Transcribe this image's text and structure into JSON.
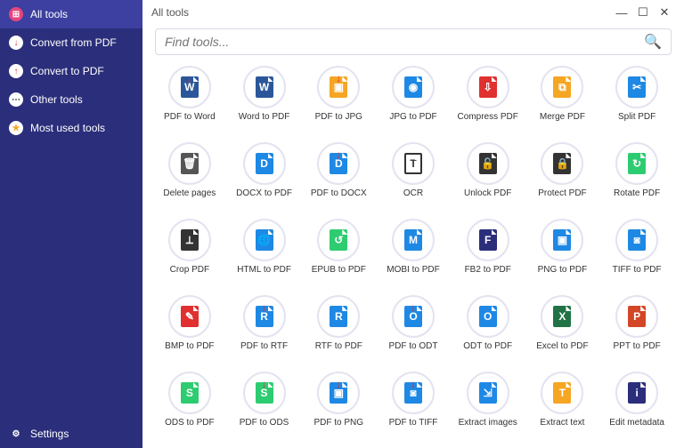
{
  "header": {
    "title": "All tools"
  },
  "search": {
    "placeholder": "Find tools..."
  },
  "win_controls": {
    "minimize": "—",
    "maximize": "☐",
    "close": "✕"
  },
  "sidebar": {
    "items": [
      {
        "label": "All tools",
        "icon_color": "#e5457e",
        "glyph": "⊞",
        "active": true
      },
      {
        "label": "Convert from PDF",
        "icon_color": "#ffffff",
        "glyph": "↓",
        "glyph_color": "#e03030"
      },
      {
        "label": "Convert to PDF",
        "icon_color": "#ffffff",
        "glyph": "↑",
        "glyph_color": "#e03030"
      },
      {
        "label": "Other tools",
        "icon_color": "#ffffff",
        "glyph": "⋯",
        "glyph_color": "#333"
      },
      {
        "label": "Most used tools",
        "icon_color": "#ffffff",
        "glyph": "★",
        "glyph_color": "#f5a623"
      }
    ],
    "settings": {
      "label": "Settings",
      "glyph": "⚙"
    }
  },
  "tools": [
    {
      "label": "PDF to Word",
      "color": "#2b579a",
      "glyph": "W",
      "arrow": true
    },
    {
      "label": "Word to PDF",
      "color": "#2b579a",
      "glyph": "W"
    },
    {
      "label": "PDF to JPG",
      "color": "#f5a623",
      "glyph": "▣",
      "arrow": true
    },
    {
      "label": "JPG to PDF",
      "color": "#1e88e5",
      "glyph": "◉"
    },
    {
      "label": "Compress PDF",
      "color": "#e03030",
      "glyph": "⇩"
    },
    {
      "label": "Merge PDF",
      "color": "#f5a623",
      "glyph": "⧉"
    },
    {
      "label": "Split PDF",
      "color": "#1e88e5",
      "glyph": "✂"
    },
    {
      "label": "Delete pages",
      "color": "#555",
      "glyph": "🗑"
    },
    {
      "label": "DOCX to PDF",
      "color": "#1e88e5",
      "glyph": "D"
    },
    {
      "label": "PDF to DOCX",
      "color": "#1e88e5",
      "glyph": "D",
      "arrow": true
    },
    {
      "label": "OCR",
      "color": "#333",
      "glyph": "T",
      "outline": true
    },
    {
      "label": "Unlock PDF",
      "color": "#333",
      "glyph": "🔓"
    },
    {
      "label": "Protect PDF",
      "color": "#333",
      "glyph": "🔒"
    },
    {
      "label": "Rotate PDF",
      "color": "#2ecc71",
      "glyph": "↻"
    },
    {
      "label": "Crop PDF",
      "color": "#333",
      "glyph": "⟂"
    },
    {
      "label": "HTML to PDF",
      "color": "#1e88e5",
      "glyph": "🌐"
    },
    {
      "label": "EPUB to PDF",
      "color": "#2ecc71",
      "glyph": "↺"
    },
    {
      "label": "MOBI to PDF",
      "color": "#1e88e5",
      "glyph": "M"
    },
    {
      "label": "FB2 to PDF",
      "color": "#2b2e7a",
      "glyph": "F"
    },
    {
      "label": "PNG to PDF",
      "color": "#1e88e5",
      "glyph": "▣"
    },
    {
      "label": "TIFF to PDF",
      "color": "#1e88e5",
      "glyph": "◙"
    },
    {
      "label": "BMP to PDF",
      "color": "#e03030",
      "glyph": "✎"
    },
    {
      "label": "PDF to RTF",
      "color": "#1e88e5",
      "glyph": "R",
      "arrow": true
    },
    {
      "label": "RTF to PDF",
      "color": "#1e88e5",
      "glyph": "R"
    },
    {
      "label": "PDF to ODT",
      "color": "#1e88e5",
      "glyph": "O",
      "arrow": true
    },
    {
      "label": "ODT to PDF",
      "color": "#1e88e5",
      "glyph": "O"
    },
    {
      "label": "Excel to PDF",
      "color": "#217346",
      "glyph": "X"
    },
    {
      "label": "PPT to PDF",
      "color": "#d24726",
      "glyph": "P"
    },
    {
      "label": "ODS to PDF",
      "color": "#2ecc71",
      "glyph": "S"
    },
    {
      "label": "PDF to ODS",
      "color": "#2ecc71",
      "glyph": "S",
      "arrow": true
    },
    {
      "label": "PDF to PNG",
      "color": "#1e88e5",
      "glyph": "▣",
      "arrow": true
    },
    {
      "label": "PDF to TIFF",
      "color": "#1e88e5",
      "glyph": "◙",
      "arrow": true
    },
    {
      "label": "Extract images",
      "color": "#1e88e5",
      "glyph": "⇲"
    },
    {
      "label": "Extract text",
      "color": "#f5a623",
      "glyph": "T"
    },
    {
      "label": "Edit metadata",
      "color": "#2b2e7a",
      "glyph": "i"
    }
  ]
}
